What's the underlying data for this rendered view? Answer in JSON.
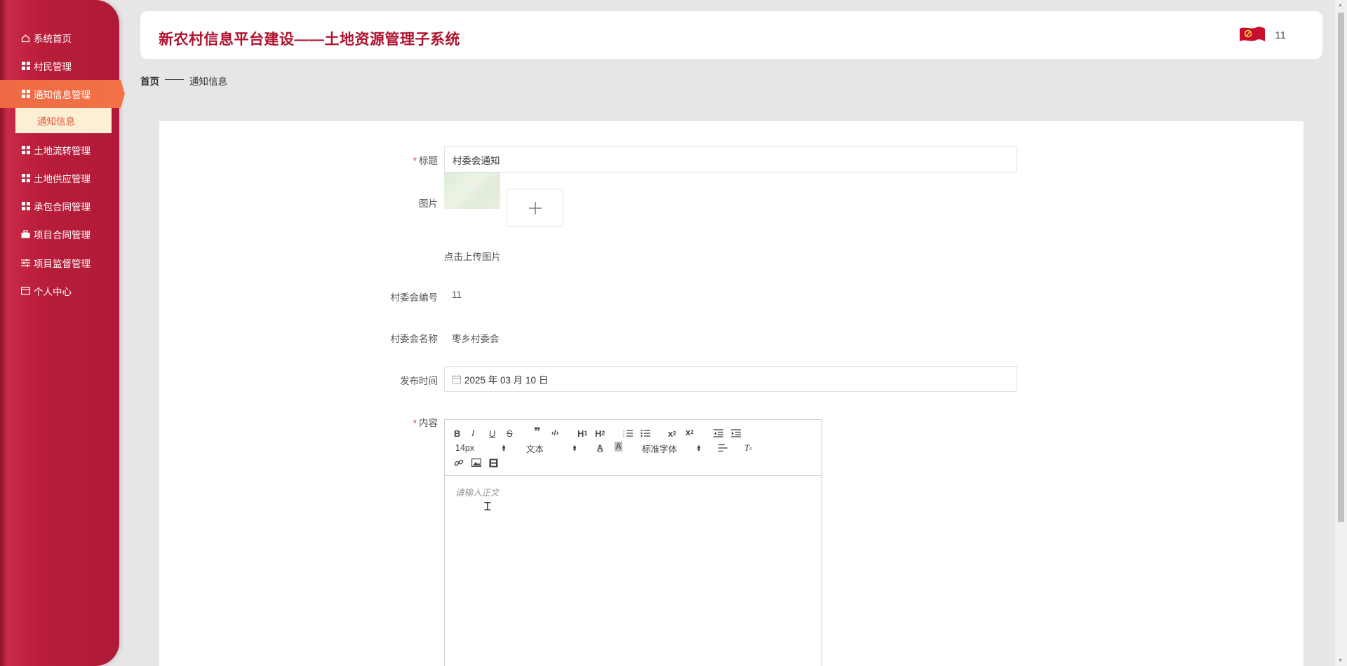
{
  "sidebar": {
    "items": [
      {
        "label": "系统首页",
        "icon": "home-icon"
      },
      {
        "label": "村民管理",
        "icon": "grid-icon"
      },
      {
        "label": "通知信息管理",
        "icon": "grid-icon",
        "active": true
      },
      {
        "label": "土地流转管理",
        "icon": "grid-icon"
      },
      {
        "label": "土地供应管理",
        "icon": "grid-icon"
      },
      {
        "label": "承包合同管理",
        "icon": "grid-icon"
      },
      {
        "label": "项目合同管理",
        "icon": "briefcase-icon"
      },
      {
        "label": "项目监督管理",
        "icon": "sliders-icon"
      },
      {
        "label": "个人中心",
        "icon": "card-icon"
      }
    ],
    "submenu": {
      "label": "通知信息"
    }
  },
  "header": {
    "title": "新农村信息平台建设——土地资源管理子系统",
    "user": "11"
  },
  "breadcrumb": {
    "home": "首页",
    "sep": "——",
    "current": "通知信息"
  },
  "form": {
    "title_label": "标题",
    "title_value": "村委会通知",
    "image_label": "图片",
    "upload_tip": "点击上传图片",
    "village_no_label": "村委会编号",
    "village_no_value": "11",
    "village_name_label": "村委会名称",
    "village_name_value": "枣乡村委会",
    "publish_time_label": "发布时间",
    "publish_time_value": "2025 年 03 月 10 日",
    "content_label": "内容"
  },
  "editor": {
    "font_size": "14px",
    "block_type": "文本",
    "font_family": "标准字体",
    "placeholder": "请输入正文"
  },
  "colors": {
    "brand": "#b0132f",
    "sidebar": "#b81d3a",
    "active": "#f27246",
    "submenu_bg": "#fcefd6"
  }
}
